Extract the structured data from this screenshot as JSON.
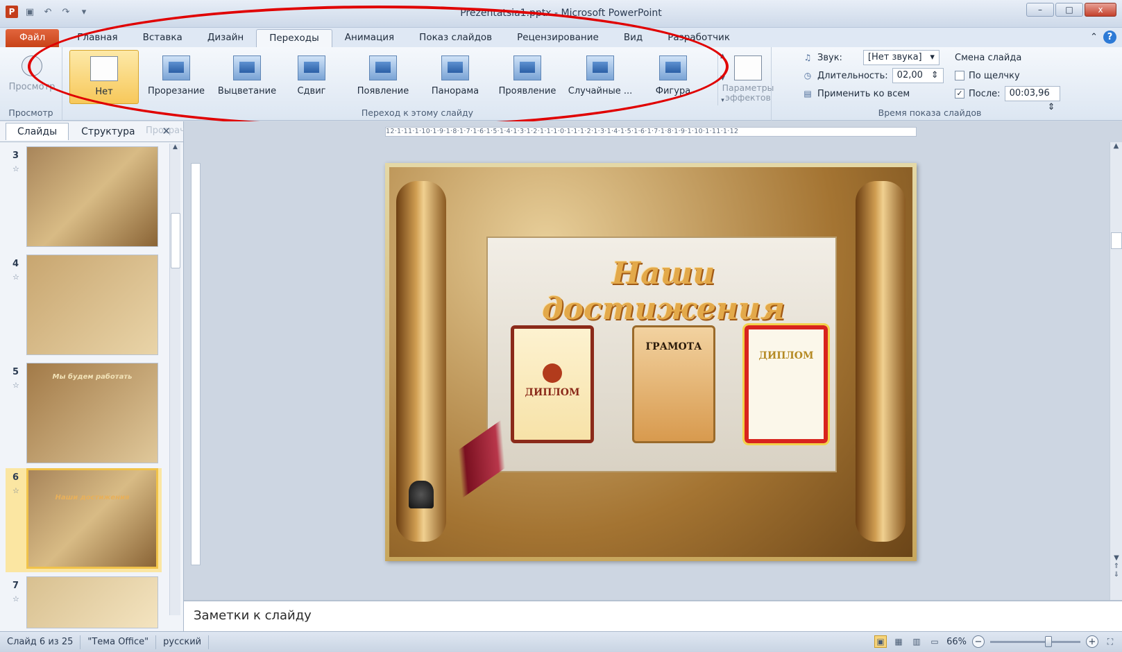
{
  "window": {
    "title": "Prezentatsia1.pptx - Microsoft PowerPoint",
    "qat": {
      "app_icon": "P",
      "save_icon": "save-icon",
      "undo_icon": "undo-icon",
      "redo_icon": "redo-icon",
      "customize_icon": "customize-icon"
    },
    "controls": {
      "minimize": "–",
      "maximize": "□",
      "close": "x"
    }
  },
  "tabs": [
    {
      "label": "Файл"
    },
    {
      "label": "Главная"
    },
    {
      "label": "Вставка"
    },
    {
      "label": "Дизайн"
    },
    {
      "label": "Переходы"
    },
    {
      "label": "Анимация"
    },
    {
      "label": "Показ слайдов"
    },
    {
      "label": "Рецензирование"
    },
    {
      "label": "Вид"
    },
    {
      "label": "Разработчик"
    }
  ],
  "help": {
    "minimize_ribbon": "⌃",
    "help": "?"
  },
  "ribbon": {
    "preview_group": {
      "button": "Просмотр",
      "label": "Просмотр"
    },
    "transitions_group": {
      "label": "Переход к этому слайду",
      "items": [
        {
          "label": "Нет"
        },
        {
          "label": "Прорезание"
        },
        {
          "label": "Выцветание"
        },
        {
          "label": "Сдвиг"
        },
        {
          "label": "Появление"
        },
        {
          "label": "Панорама"
        },
        {
          "label": "Проявление"
        },
        {
          "label": "Случайные ..."
        },
        {
          "label": "Фигура"
        }
      ],
      "effect_options": "Параметры эффектов"
    },
    "timing_group": {
      "label": "Время показа слайдов",
      "sound_label": "Звук:",
      "sound_value": "[Нет звука]",
      "duration_label": "Длительность:",
      "duration_value": "02,00",
      "apply_all": "Применить ко всем",
      "advance_title": "Смена слайда",
      "on_click_label": "По щелчку",
      "on_click_checked": false,
      "after_label": "После:",
      "after_checked": true,
      "after_value": "00:03,96"
    }
  },
  "left_panel": {
    "tabs": [
      "Слайды",
      "Структура"
    ],
    "ghost_text": "Прозрачное",
    "close": "✕",
    "slides": [
      {
        "number": "3",
        "title": ""
      },
      {
        "number": "4",
        "title": ""
      },
      {
        "number": "5",
        "title": "Мы будем работать"
      },
      {
        "number": "6",
        "title": "Наши достижения",
        "current": true
      },
      {
        "number": "7",
        "title": ""
      }
    ]
  },
  "ruler": {
    "horizontal": "12·1·11·1·10·1·9·1·8·1·7·1·6·1·5·1·4·1·3·1·2·1·1·1·0·1·1·1·2·1·3·1·4·1·5·1·6·1·7·1·8·1·9·1·10·1·11·1·12"
  },
  "slide": {
    "title": "Наши достижения",
    "certificates": [
      "ДИПЛОМ",
      "ГРАМОТА",
      "ДИПЛОМ"
    ]
  },
  "notes": {
    "placeholder": "Заметки к слайду"
  },
  "status": {
    "slide": "Слайд 6 из 25",
    "theme": "\"Тема Office\"",
    "language": "русский",
    "zoom": "66%",
    "zoom_fraction": 0.66
  }
}
